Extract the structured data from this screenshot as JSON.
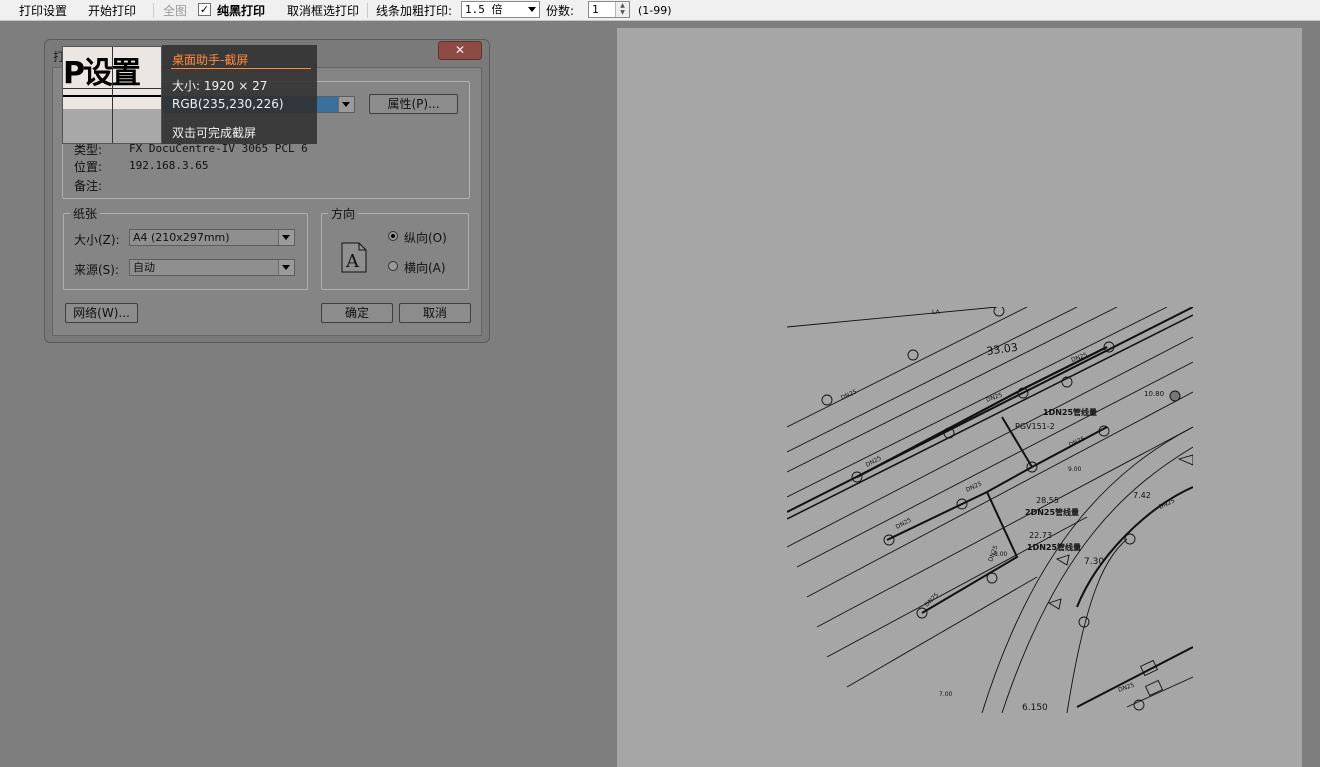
{
  "toolbar": {
    "print_setup": "打印设置",
    "start_print": "开始打印",
    "whole_image": "全图",
    "pure_black": "纯黑打印",
    "cancel_frame": "取消框选打印",
    "line_bold_label": "线条加粗打印:",
    "line_bold_value": "1.5 倍",
    "copies_label": "份数:",
    "copies_value": "1",
    "copies_range": "(1-99)"
  },
  "dialog": {
    "title_partial": "打",
    "close": "✕",
    "printer": {
      "name_value": "",
      "properties_button": "属性(P)...",
      "type_label": "类型:",
      "type_value": "FX DocuCentre-IV 3065 PCL 6",
      "location_label": "位置:",
      "location_value": "192.168.3.65",
      "comment_label": "备注:"
    },
    "paper": {
      "group_label": "纸张",
      "size_label": "大小(Z):",
      "size_value": "A4 (210x297mm)",
      "source_label": "来源(S):",
      "source_value": "自动"
    },
    "orientation": {
      "group_label": "方向",
      "portrait": "纵向(O)",
      "landscape": "横向(A)",
      "selected": "portrait"
    },
    "network_button": "网络(W)...",
    "ok_button": "确定",
    "cancel_button": "取消"
  },
  "capture_tool": {
    "magnified_text": "P设置",
    "title": "桌面助手-截屏",
    "size": "大小: 1920 × 27",
    "rgb": "RGB(235,230,226)",
    "hint": "双击可完成截屏"
  },
  "drawing": {
    "labels": [
      "33.03",
      "PGV151-2",
      "1DN25管线量",
      "2DN25管线量",
      "1DN25管线量",
      "28.55",
      "22.73",
      "7.30",
      "7.42",
      "6.150",
      "10.80",
      "9.00",
      "8.00",
      "7.00",
      "LA"
    ],
    "pipe_labels": [
      "DN25",
      "DN25",
      "DN25",
      "DN25",
      "DN25",
      "DN25",
      "DN25",
      "DN25",
      "DN25",
      "DN25",
      "DN25"
    ]
  }
}
